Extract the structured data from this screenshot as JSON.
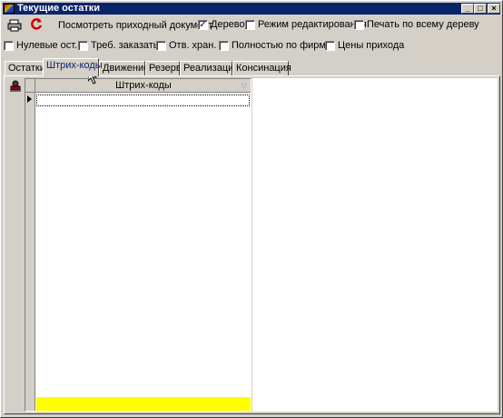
{
  "window": {
    "title": "Текущие остатки",
    "controls": {
      "minimize": "_",
      "maximize": "□",
      "close": "×"
    }
  },
  "toolbar": {
    "print_icon": "printer-icon",
    "refresh_icon": "refresh-icon",
    "view_incoming_label": "Посмотреть приходный документ",
    "options_row1": [
      {
        "label": "Дерево",
        "checked": true
      },
      {
        "label": "Режим редактирования",
        "checked": false
      },
      {
        "label": "Печать по всему дереву",
        "checked": false
      }
    ],
    "options_row2": [
      {
        "label": "Нулевые ост.",
        "checked": false
      },
      {
        "label": "Треб. заказать",
        "checked": false
      },
      {
        "label": "Отв. хран.",
        "checked": false
      },
      {
        "label": "Полностью по фирме",
        "checked": false
      },
      {
        "label": "Цены прихода",
        "checked": false
      }
    ]
  },
  "tabs": [
    {
      "label": "Остатки",
      "active": false
    },
    {
      "label": "Штрих-коды",
      "active": true
    },
    {
      "label": "Движение",
      "active": false
    },
    {
      "label": "Резерв",
      "active": false
    },
    {
      "label": "Реализация",
      "active": false
    },
    {
      "label": "Консинация",
      "active": false
    }
  ],
  "panel": {
    "side_icon": "stamp-icon",
    "grid": {
      "columns": [
        "Штрих-коды"
      ],
      "rows": [
        ""
      ]
    }
  },
  "colors": {
    "title_bar": "#0a246a",
    "face": "#d4d0c8",
    "footer": "#ffff00"
  }
}
